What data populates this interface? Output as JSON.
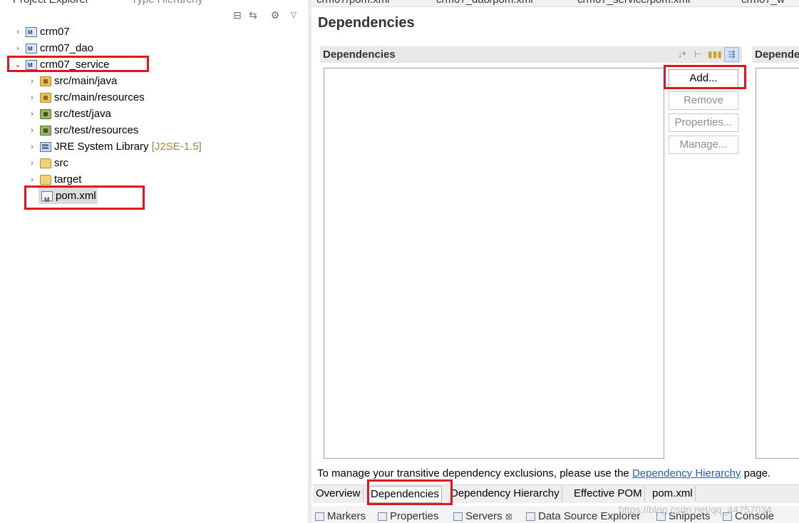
{
  "project_explorer": {
    "tabs": [
      "Project Explorer",
      "Type Hierarchy"
    ],
    "toolbar": [
      "collapse-all-icon",
      "link-with-editor-icon",
      "focus-icon",
      "view-menu-icon"
    ],
    "tree": [
      {
        "label": "crm07",
        "decoration": "",
        "expanded": false,
        "icon": "maven-project-icon",
        "level": 0
      },
      {
        "label": "crm07_dao",
        "decoration": "",
        "expanded": false,
        "icon": "maven-project-icon",
        "level": 0
      },
      {
        "label": "crm07_service",
        "decoration": "",
        "expanded": true,
        "icon": "maven-project-icon",
        "level": 0
      },
      {
        "label": "src/main/java",
        "decoration": "",
        "expanded": false,
        "icon": "source-folder-icon",
        "level": 1
      },
      {
        "label": "src/main/resources",
        "decoration": "",
        "expanded": false,
        "icon": "source-folder-icon",
        "level": 1
      },
      {
        "label": "src/test/java",
        "decoration": "",
        "expanded": false,
        "icon": "test-source-folder-icon",
        "level": 1
      },
      {
        "label": "src/test/resources",
        "decoration": "",
        "expanded": false,
        "icon": "test-source-folder-icon",
        "level": 1
      },
      {
        "label": "JRE System Library",
        "decoration": "[J2SE-1.5]",
        "expanded": false,
        "icon": "library-icon",
        "level": 1
      },
      {
        "label": "src",
        "decoration": "",
        "expanded": false,
        "icon": "folder-icon",
        "level": 1
      },
      {
        "label": "target",
        "decoration": "",
        "expanded": false,
        "icon": "folder-icon",
        "level": 1
      },
      {
        "label": "pom.xml",
        "decoration": "",
        "expanded": null,
        "icon": "pom-file-icon",
        "level": 1,
        "selected": true
      }
    ]
  },
  "editor": {
    "tabs": [
      "crm07/pom.xml",
      "crm07_dao/pom.xml",
      "crm07_service/pom.xml",
      "crm07_w"
    ],
    "form_title": "Dependencies",
    "dependencies_section": {
      "title": "Dependencies",
      "header_buttons": [
        "sort-alphabetically-icon",
        "show-groupid-icon",
        "show-version-icon",
        "filter-icon"
      ],
      "buttons": {
        "add": "Add...",
        "remove": "Remove",
        "properties": "Properties...",
        "manage": "Manage..."
      }
    },
    "management_section": {
      "title": "Dependency Management"
    },
    "note": {
      "prefix": "To manage your transitive dependency exclusions, please use the ",
      "link": "Dependency Hierarchy",
      "suffix": " page."
    },
    "page_tabs": [
      "Overview",
      "Dependencies",
      "Dependency Hierarchy",
      "Effective POM",
      "pom.xml"
    ],
    "active_page_tab": "Dependencies"
  },
  "bottom_views": [
    "Markers",
    "Properties",
    "Servers",
    "Data Source Explorer",
    "Snippets",
    "Console"
  ],
  "watermark": "https://blog.csdn.net/qq_44757034",
  "colors": {
    "highlight_box": "#e3141b",
    "link": "#1d5fc4",
    "decoration": "#a08840"
  }
}
